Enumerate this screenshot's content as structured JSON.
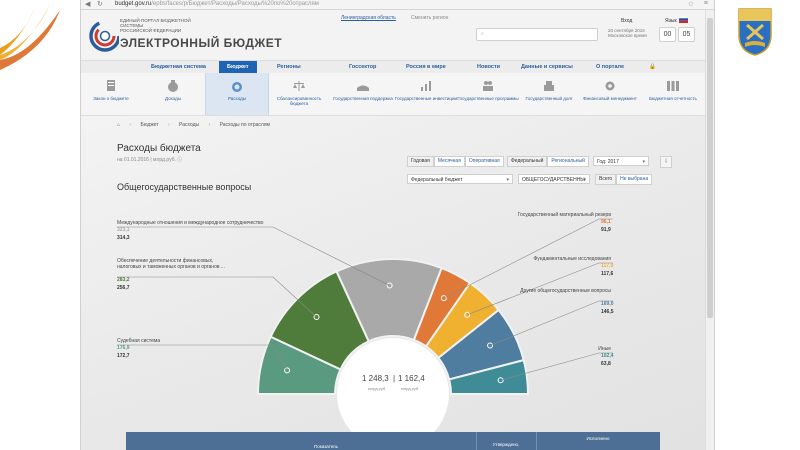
{
  "browser": {
    "url_host": "budget.gov.ru",
    "url_path": "/epbs/faces/p/Бюджет/Расходы/Расходы%20по%20отраслям"
  },
  "site": {
    "subtitle_lines": [
      "ЕДИНЫЙ ПОРТАЛ БЮДЖЕТНОЙ СИСТЕМЫ",
      "РОССИЙСКОЙ ФЕДЕРАЦИИ"
    ],
    "title": "ЭЛЕКТРОННЫЙ БЮДЖЕТ",
    "region": "Ленинградская область",
    "region_change": "Сменить регион",
    "login": "Вход",
    "lang": "Язык",
    "date_line1": "20 сентября 2016",
    "date_line2": "Московское время",
    "clock_h": "00",
    "clock_m": "05"
  },
  "nav": {
    "items": [
      "Бюджетная система",
      "Бюджет",
      "Регионы",
      "Госсектор",
      "Россия в мире",
      "Новости",
      "Данные и сервисы",
      "О портале"
    ]
  },
  "sections": [
    {
      "label": "Закон о бюджете"
    },
    {
      "label": "Доходы"
    },
    {
      "label": "Расходы"
    },
    {
      "label": "Сбалансированность бюджета"
    },
    {
      "label": "Государственная поддержка"
    },
    {
      "label": "Государственные инвестиции"
    },
    {
      "label": "Государственные программы"
    },
    {
      "label": "Государственный долг"
    },
    {
      "label": "Финансовый менеджмент"
    },
    {
      "label": "Бюджетная отчетность"
    }
  ],
  "breadcrumb": [
    "Бюджет",
    "Расходы",
    "Расходы по отраслям"
  ],
  "page": {
    "title": "Расходы бюджета",
    "subtitle": "на 01.01.2016 | млрд.руб.",
    "section_title": "Общегосударственные вопросы"
  },
  "controls": {
    "periods": [
      "Годовая",
      "Месячная",
      "Оперативная"
    ],
    "levels": [
      "Федеральный",
      "Региональный"
    ],
    "year": "Год: 2017",
    "budget_select": "Федеральный бюджет",
    "category_select": "ОБЩЕГОСУДАРСТВЕННЫ",
    "all_label": "Всего",
    "not_selected": "Не выбрана"
  },
  "colors": {
    "accent_blue": "#1f64b3",
    "dark_green": "#4f7c3b",
    "teal_green": "#5a9a80",
    "grey": "#a9a9a9",
    "orange": "#e07838",
    "yellow": "#f0b030",
    "steel_blue": "#4f7da0",
    "teal": "#3f8c96",
    "light_green": "#77b39e"
  },
  "chart_data": {
    "type": "pie",
    "title": "Общегосударственные вопросы",
    "unit": "млрд.руб.",
    "total_a": "1 248,3",
    "total_b": "1 162,4",
    "series": [
      {
        "name": "Судебная система",
        "value_a": "176,9",
        "value_b": "172,7",
        "color": "#5a9a80"
      },
      {
        "name": "Обеспечение деятельности финансовых, налоговых и таможенных органов и органов ...",
        "value_a": "283,2",
        "value_b": "256,7",
        "color": "#4f7c3b"
      },
      {
        "name": "Международные отношения и международное сотрудничество",
        "value_a": "323,1",
        "value_b": "314,3",
        "color": "#a9a9a9"
      },
      {
        "name": "Государственный материальный резерв",
        "value_a": "96,1",
        "value_b": "91,9",
        "color": "#e07838"
      },
      {
        "name": "Фундаментальные исследования",
        "value_a": "117,9",
        "value_b": "117,6",
        "color": "#f0b030"
      },
      {
        "name": "Другие общегосударственные вопросы",
        "value_a": "169,0",
        "value_b": "146,5",
        "color": "#4f7da0"
      },
      {
        "name": "Иные",
        "value_a": "102,4",
        "value_b": "63,8",
        "color": "#3f8c96"
      }
    ]
  },
  "table": {
    "col1": "Показатель",
    "col2": "Утверждено,",
    "col3": "Исполнено"
  }
}
